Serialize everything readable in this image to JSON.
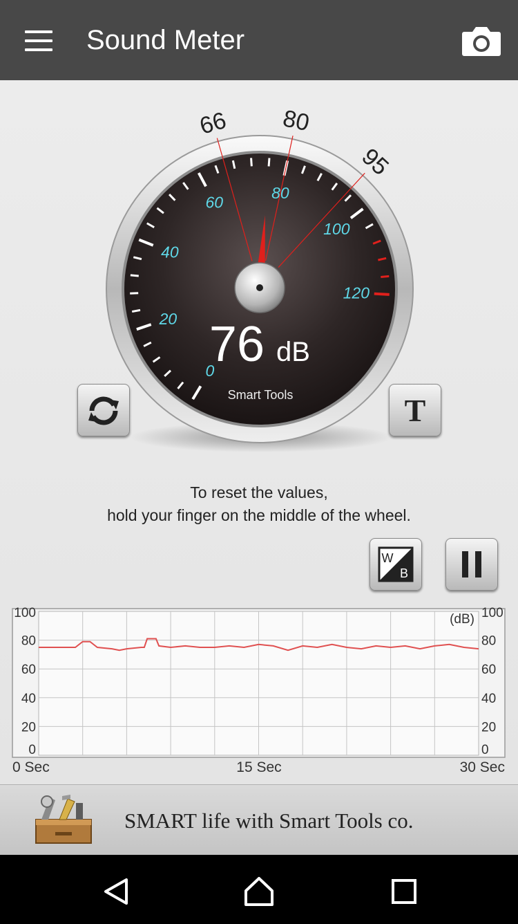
{
  "appbar": {
    "title": "Sound Meter",
    "menu_icon": "hamburger-menu-icon",
    "camera_icon": "camera-icon"
  },
  "gauge": {
    "value": 76,
    "value_text": "76",
    "unit": "dB",
    "brand": "Smart Tools",
    "scale_min": 0,
    "scale_max": 120,
    "scale_labels": [
      "0",
      "20",
      "40",
      "60",
      "80",
      "100",
      "120"
    ],
    "min_marker": 66,
    "avg_marker": 80,
    "max_marker": 95,
    "min_marker_label": "66",
    "avg_marker_label": "80",
    "max_marker_label": "95",
    "label_color": "#5fd8e8",
    "needle_color": "#e0201c"
  },
  "buttons": {
    "reset_icon": "refresh-icon",
    "text_icon_letter": "T",
    "wb_icon_letters": [
      "W",
      "B"
    ],
    "pause_icon": "pause-icon"
  },
  "hint": {
    "line1": "To reset the values,",
    "line2": "hold your finger on the middle of the wheel."
  },
  "chart_data": {
    "type": "line",
    "title": "",
    "xlabel": "",
    "ylabel": "(dB)",
    "unit_label": "(dB)",
    "xlim": [
      0,
      30
    ],
    "ylim": [
      0,
      100
    ],
    "x_tick_labels": [
      "0 Sec",
      "15 Sec",
      "30 Sec"
    ],
    "y_tick_labels": [
      "100",
      "80",
      "60",
      "40",
      "20",
      "0"
    ],
    "grid": true,
    "series": [
      {
        "color": "#e05050",
        "x": [
          0,
          1,
          2,
          2.5,
          3,
          3.5,
          4,
          5,
          5.5,
          6,
          7,
          7.2,
          7.4,
          8,
          8.2,
          9,
          10,
          11,
          12,
          13,
          14,
          15,
          16,
          17,
          18,
          19,
          20,
          21,
          22,
          23,
          24,
          25,
          26,
          27,
          28,
          29,
          30
        ],
        "values": [
          75,
          75,
          75,
          75,
          79,
          79,
          75,
          74,
          73,
          74,
          75,
          75,
          81,
          81,
          76,
          75,
          76,
          75,
          75,
          76,
          75,
          77,
          76,
          73,
          76,
          75,
          77,
          75,
          74,
          76,
          75,
          76,
          74,
          76,
          77,
          75,
          74
        ]
      }
    ]
  },
  "ad": {
    "text": "SMART life with Smart Tools co.",
    "logo_icon": "toolbox-logo-icon"
  },
  "navbar": {
    "back_icon": "back-triangle-icon",
    "home_icon": "home-icon",
    "recents_icon": "recents-square-icon"
  }
}
